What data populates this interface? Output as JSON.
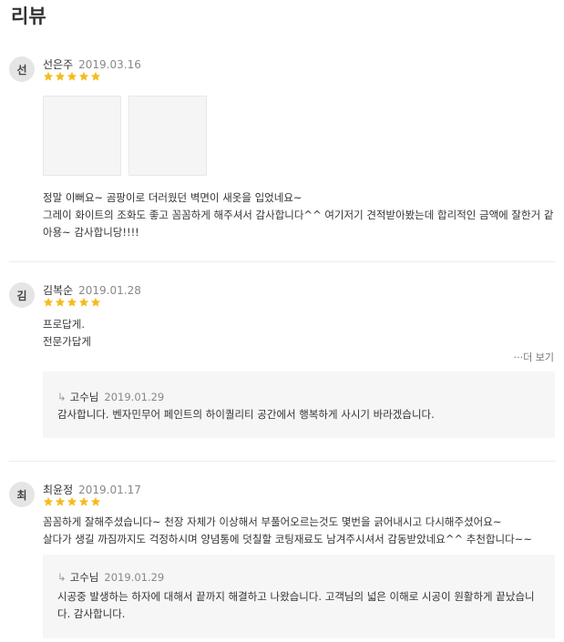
{
  "section": {
    "title": "리뷰"
  },
  "reviews": [
    {
      "avatar": "선",
      "name": "선은주",
      "date": "2019.03.16",
      "rating": 5,
      "lines": [
        "정말 이뻐요~ 곰팡이로 더러웠던 벽면이 새옷을 입었네요~",
        "그레이 화이트의 조화도 좋고 꼼꼼하게 해주셔서 감사합니다^^ 여기저기 견적받아봤는데 합리적인 금액에 잘한거 같",
        "아용~ 감사합니당!!!!"
      ]
    },
    {
      "avatar": "김",
      "name": "김복순",
      "date": "2019.01.28",
      "rating": 5,
      "lines": [
        "프로답게.",
        "전문가답게"
      ],
      "more_label": "···더 보기",
      "reply": {
        "author": "고수님",
        "date": "2019.01.29",
        "lines": [
          "감사합니다. 벤자민무어 페인트의 하이퀄리티 공간에서 행복하게 사시기 바라겠습니다."
        ]
      }
    },
    {
      "avatar": "최",
      "name": "최윤정",
      "date": "2019.01.17",
      "rating": 5,
      "lines": [
        "꼼꼼하게 잘해주셨습니다~ 천장 자체가 이상해서 부풀어오르는것도 몇번을 긁어내시고 다시해주셨어요~",
        "살다가 생길 까짐까지도 걱정하시며 양념통에 덧칠할 코팅재료도 남겨주시셔서 감동받았네요^^ 추천합니다~~"
      ],
      "reply": {
        "author": "고수님",
        "date": "2019.01.29",
        "lines": [
          "시공중 발생하는 하자에 대해서 끝까지 해결하고 나왔습니다. 고객님의 넓은 이해로 시공이 원활하게 끝났습니",
          "다. 감사합니다."
        ]
      }
    }
  ],
  "colors": {
    "star": "#f5bc1c",
    "avatar_bg": "#e5e5e5",
    "reply_bg": "#f6f6f6"
  }
}
